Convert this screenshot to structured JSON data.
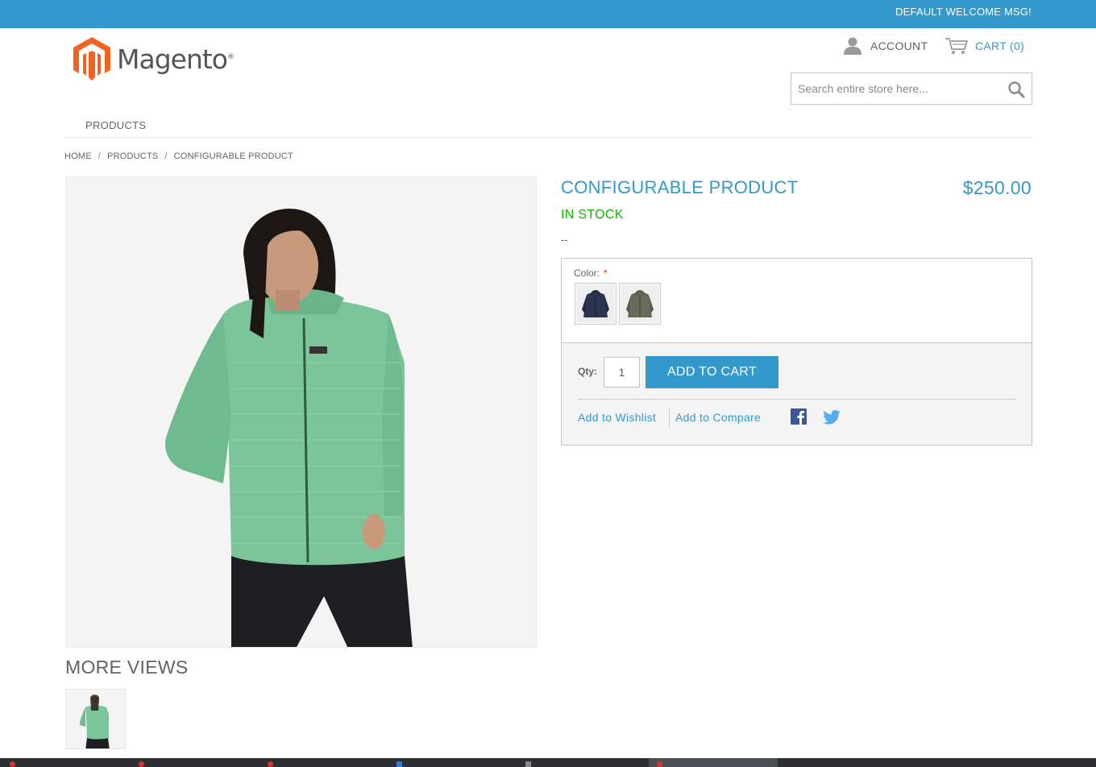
{
  "header": {
    "welcome": "DEFAULT WELCOME MSG!",
    "logo_text": "Magento",
    "logo_reg": "®",
    "account_label": "ACCOUNT",
    "cart_label": "CART",
    "cart_count": "(0)",
    "search_placeholder": "Search entire store here..."
  },
  "nav": {
    "items": [
      {
        "label": "PRODUCTS"
      }
    ]
  },
  "breadcrumb": {
    "home": "HOME",
    "products": "PRODUCTS",
    "current": "CONFIGURABLE PRODUCT",
    "sep": "/"
  },
  "product": {
    "name": "CONFIGURABLE PRODUCT",
    "price": "$250.00",
    "stock": "IN STOCK",
    "short_description": "--",
    "more_views": "MORE VIEWS",
    "options": {
      "color_label": "Color:",
      "required_mark": "*",
      "swatches": [
        {
          "color": "#2b3550"
        },
        {
          "color": "#6a6a5c"
        }
      ]
    },
    "jacket_color": "#6fbf8e",
    "add_to": {
      "qty_label": "Qty:",
      "qty_value": "1",
      "add_button": "ADD TO CART",
      "wishlist": "Add to Wishlist",
      "compare": "Add to Compare"
    }
  },
  "icons": {
    "account": "person-icon",
    "cart": "cart-icon",
    "search": "magnifier-icon",
    "facebook": "facebook-icon",
    "twitter": "twitter-icon"
  },
  "colors": {
    "brand_blue": "#3399cc",
    "stock_green": "#11b400",
    "logo_orange": "#f26322"
  }
}
